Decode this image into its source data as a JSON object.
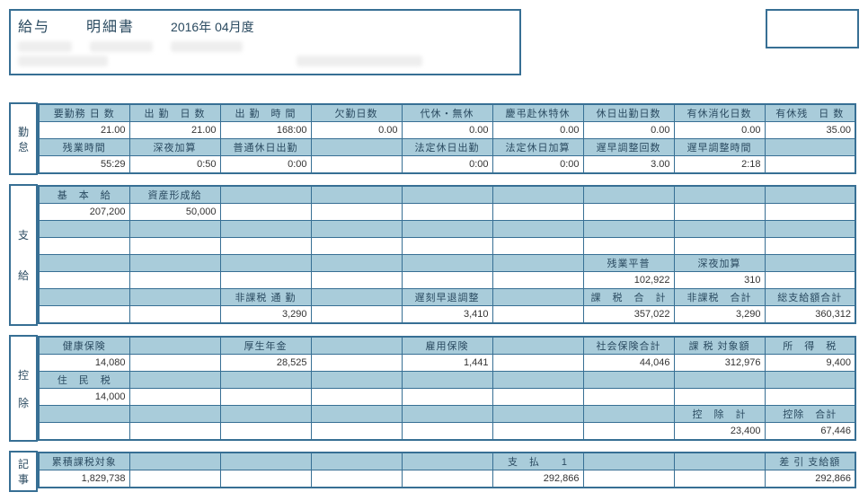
{
  "header": {
    "title1": "給与",
    "title2": "明細書",
    "period": "2016年 04月度"
  },
  "sections": {
    "kintai": "勤怠",
    "shikyu_top": "支",
    "shikyu_bottom": "給",
    "koujo_top": "控",
    "koujo_bottom": "除",
    "kiji": "記事"
  },
  "kintai": {
    "row1": {
      "c0": "要勤務 日 数",
      "c1": "出 勤　日 数",
      "c2": "出 勤　時 間",
      "c3": "欠勤日数",
      "c4": "代休・無休",
      "c5": "慶弔赴休特休",
      "c6": "休日出勤日数",
      "c7": "有休消化日数",
      "c8": "有休残　日 数"
    },
    "row1v": {
      "c0": "21.00",
      "c1": "21.00",
      "c2": "168:00",
      "c3": "0.00",
      "c4": "0.00",
      "c5": "0.00",
      "c6": "0.00",
      "c7": "0.00",
      "c8": "35.00"
    },
    "row2": {
      "c0": "残業時間",
      "c1": "深夜加算",
      "c2": "普通休日出勤",
      "c4": "法定休日出勤",
      "c5": "法定休日加算",
      "c6": "遅早調整回数",
      "c7": "遅早調整時間"
    },
    "row2v": {
      "c0": "55:29",
      "c1": "0:50",
      "c2": "0:00",
      "c4": "0:00",
      "c5": "0:00",
      "c6": "3.00",
      "c7": "2:18"
    }
  },
  "shikyu": {
    "row1": {
      "c0": "基　本　給",
      "c1": "資産形成給"
    },
    "row1v": {
      "c0": "207,200",
      "c1": "50,000"
    },
    "row4": {
      "c6": "残業平普",
      "c7": "深夜加算"
    },
    "row4v": {
      "c6": "102,922",
      "c7": "310"
    },
    "row5": {
      "c2": "非課税 通 勤",
      "c4": "遅刻早退調整",
      "c6": "課　税　合　計",
      "c7": "非課税　合計",
      "c8": "総支給額合計"
    },
    "row5v": {
      "c2": "3,290",
      "c4": "3,410",
      "c6": "357,022",
      "c7": "3,290",
      "c8": "360,312"
    }
  },
  "koujo": {
    "row1": {
      "c0": "健康保険",
      "c2": "厚生年金",
      "c4": "雇用保険",
      "c6": "社会保険合計",
      "c7": "課 税 対象額",
      "c8": "所　得　税"
    },
    "row1v": {
      "c0": "14,080",
      "c2": "28,525",
      "c4": "1,441",
      "c6": "44,046",
      "c7": "312,976",
      "c8": "9,400"
    },
    "row2": {
      "c0": "住　民　税"
    },
    "row2v": {
      "c0": "14,000"
    },
    "row3": {
      "c7": "控　除　計",
      "c8": "控除　合計"
    },
    "row3v": {
      "c7": "23,400",
      "c8": "67,446"
    }
  },
  "kiji": {
    "row1": {
      "c0": "累積課税対象",
      "c5": "支　払　　1",
      "c8": "差 引 支給額"
    },
    "row1v": {
      "c0": "1,829,738",
      "c5": "292,866",
      "c8": "292,866"
    }
  }
}
